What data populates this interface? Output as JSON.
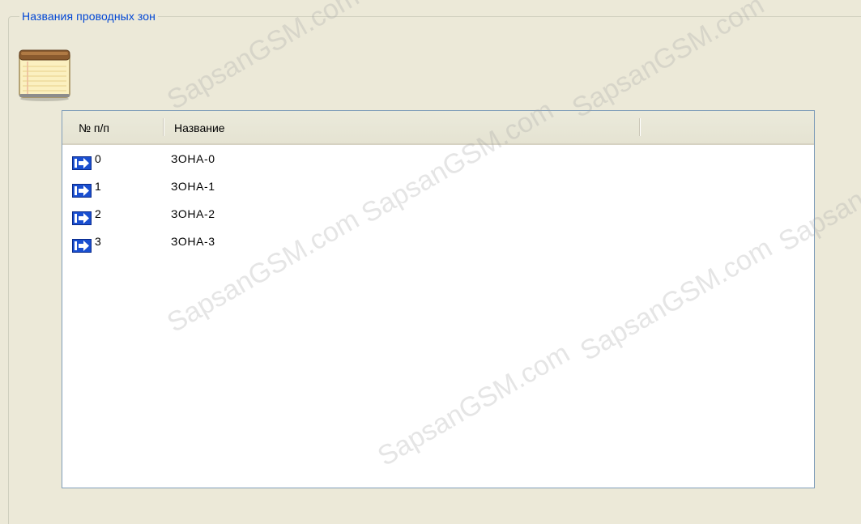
{
  "groupbox": {
    "title": "Названия проводных зон"
  },
  "icons": {
    "notepad": "notepad-icon",
    "row_arrow": "arrow-right-icon"
  },
  "list": {
    "columns": [
      {
        "label": "№ п/п"
      },
      {
        "label": "Название"
      }
    ],
    "rows": [
      {
        "num": "0",
        "name": "ЗОНА-0"
      },
      {
        "num": "1",
        "name": "ЗОНА-1"
      },
      {
        "num": "2",
        "name": "ЗОНА-2"
      },
      {
        "num": "3",
        "name": "ЗОНА-3"
      }
    ]
  },
  "watermark": {
    "text": "SapsanGSM.com"
  },
  "colors": {
    "background": "#ece9d8",
    "title_blue": "#0046d5",
    "list_border": "#7f9db9",
    "icon_blue": "#1a4fd0"
  }
}
